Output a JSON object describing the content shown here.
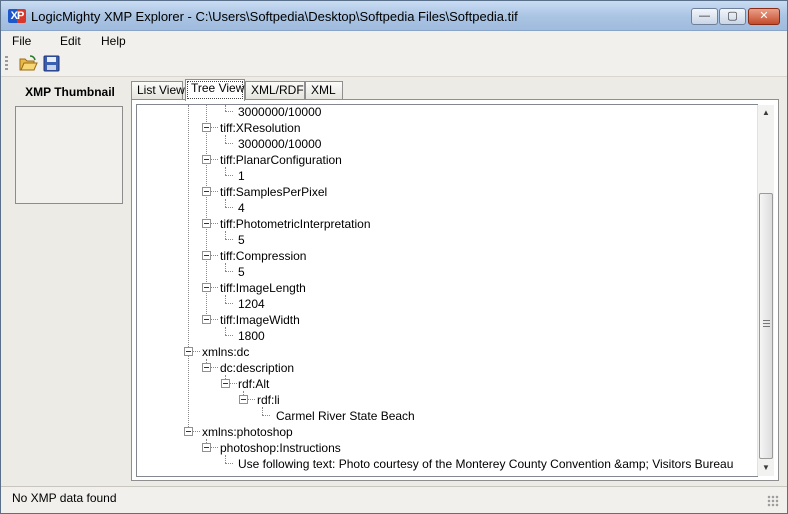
{
  "window": {
    "title": "LogicMighty XMP Explorer - C:\\Users\\Softpedia\\Desktop\\Softpedia Files\\Softpedia.tif",
    "app_icon_text": "XP",
    "controls": {
      "minimize": "—",
      "maximize": "▢",
      "close": "✕"
    }
  },
  "menu": {
    "file": "File",
    "edit": "Edit",
    "help": "Help"
  },
  "toolbar": {
    "open_icon": "folder-open-icon",
    "save_icon": "save-disk-icon"
  },
  "left_panel": {
    "title": "XMP Thumbnail"
  },
  "tabs": [
    {
      "label": "List View"
    },
    {
      "label": "Tree View"
    },
    {
      "label": "XML/RDF"
    },
    {
      "label": "XML"
    }
  ],
  "tree": [
    {
      "label": "3000000/10000"
    },
    {
      "label": "tiff:XResolution"
    },
    {
      "label": "3000000/10000"
    },
    {
      "label": "tiff:PlanarConfiguration"
    },
    {
      "label": "1"
    },
    {
      "label": "tiff:SamplesPerPixel"
    },
    {
      "label": "4"
    },
    {
      "label": "tiff:PhotometricInterpretation"
    },
    {
      "label": "5"
    },
    {
      "label": "tiff:Compression"
    },
    {
      "label": "5"
    },
    {
      "label": "tiff:ImageLength"
    },
    {
      "label": "1204"
    },
    {
      "label": "tiff:ImageWidth"
    },
    {
      "label": "1800"
    },
    {
      "label": "xmlns:dc"
    },
    {
      "label": "dc:description"
    },
    {
      "label": "rdf:Alt"
    },
    {
      "label": "rdf:li"
    },
    {
      "label": "Carmel River State Beach"
    },
    {
      "label": "xmlns:photoshop"
    },
    {
      "label": "photoshop:Instructions"
    },
    {
      "label": "Use following text: Photo courtesy of the Monterey County Convention &amp; Visitors Bureau"
    }
  ],
  "scrollbar": {
    "up": "▲",
    "down": "▼"
  },
  "status": {
    "text": "No XMP data found"
  },
  "colors": {
    "title_bar": "#a9c3e3",
    "window_face": "#ecebe6",
    "close_button": "#c44b2c"
  }
}
